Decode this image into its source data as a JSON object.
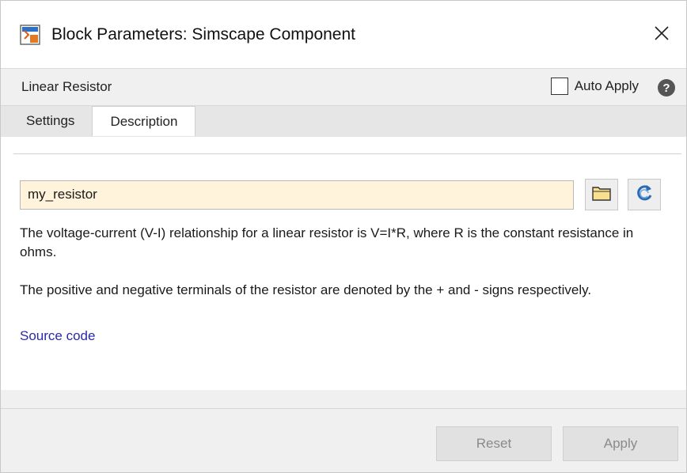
{
  "window": {
    "title": "Block Parameters: Simscape Component",
    "close_glyph": "✕",
    "icon": "simulink-block-icon"
  },
  "header": {
    "block_name": "Linear Resistor",
    "auto_apply_label": "Auto Apply",
    "auto_apply_checked": false,
    "help_glyph": "?"
  },
  "tabs": [
    {
      "label": "Settings",
      "active": false
    },
    {
      "label": "Description",
      "active": true
    }
  ],
  "description": {
    "file_value": "my_resistor",
    "browse_icon": "folder-icon",
    "refresh_icon": "refresh-icon",
    "paragraph1": "The voltage-current (V-I) relationship for a linear resistor is V=I*R, where R is the constant resistance in ohms.",
    "paragraph2": "The positive and negative terminals of the resistor are denoted by the + and - signs respectively.",
    "source_link": "Source code"
  },
  "footer": {
    "reset_label": "Reset",
    "apply_label": "Apply"
  },
  "colors": {
    "input_bg": "#fff3dc",
    "link": "#2a2aa8",
    "disabled_text": "#8a8a8a"
  }
}
